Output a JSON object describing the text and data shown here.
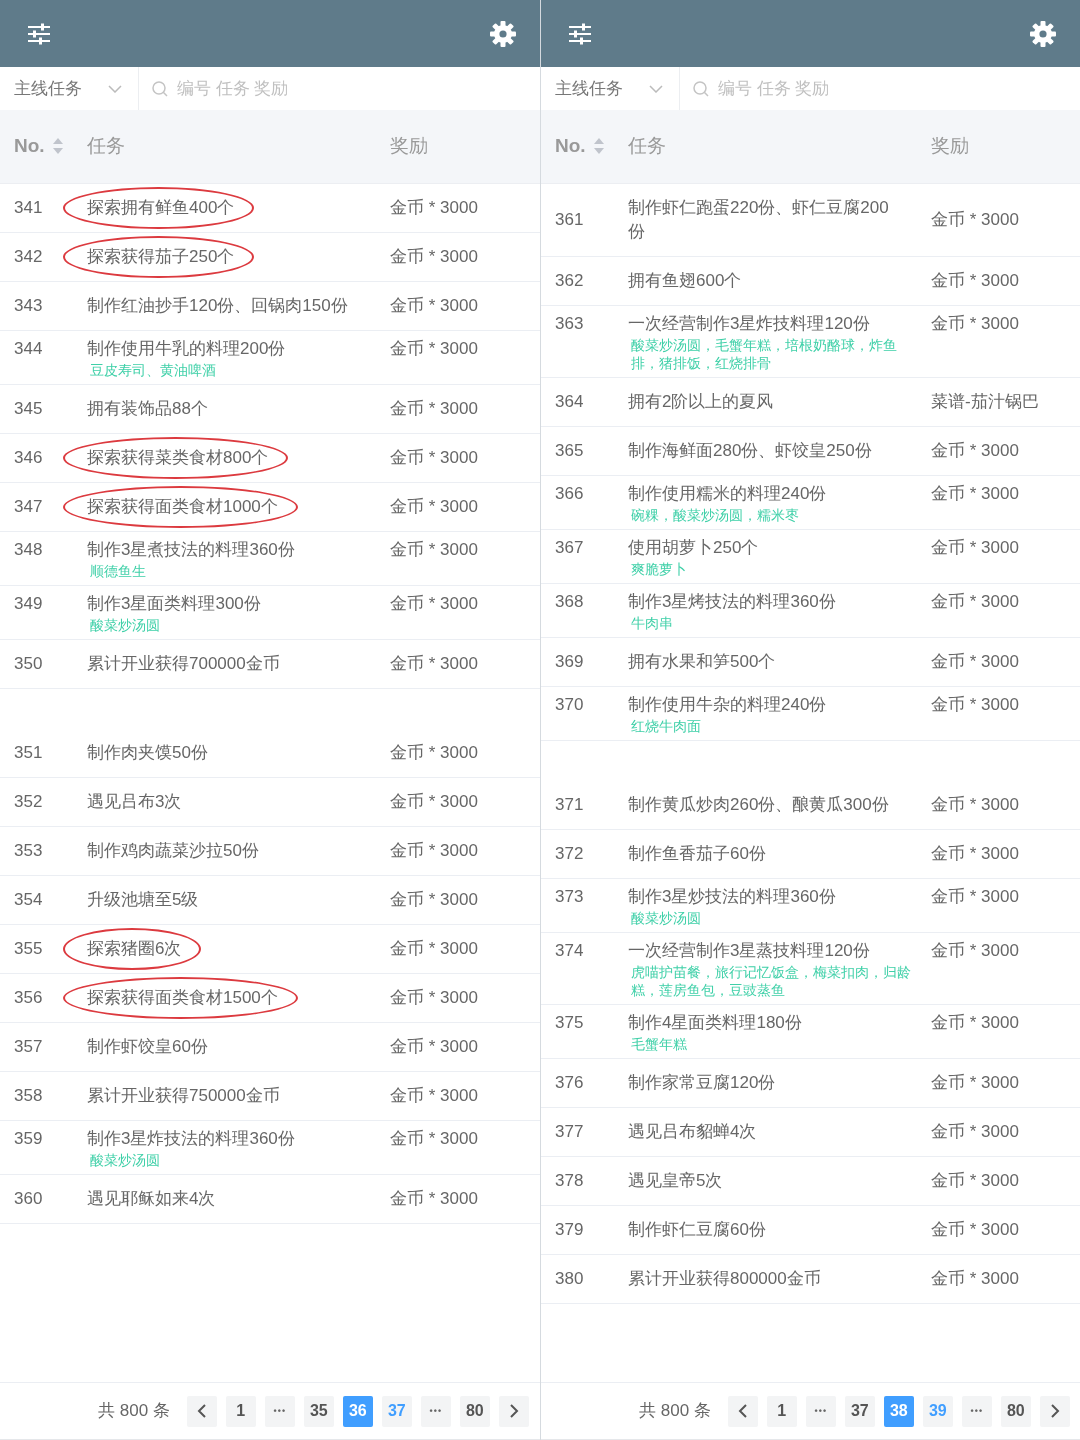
{
  "panels": [
    {
      "filter": {
        "category": "主线任务",
        "search_placeholder": "编号 任务 奖励"
      },
      "table": {
        "columns": [
          {
            "label": "No.",
            "sortable": true
          },
          {
            "label": "任务",
            "sortable": false
          },
          {
            "label": "奖励",
            "sortable": false
          }
        ],
        "sections": [
          {
            "rows": [
              {
                "no": "341",
                "task": "探索拥有鲜鱼400个",
                "reward": "金币 * 3000",
                "circled": true
              },
              {
                "no": "342",
                "task": "探索获得茄子250个",
                "reward": "金币 * 3000",
                "circled": true
              },
              {
                "no": "343",
                "task": "制作红油抄手120份、回锅肉150份",
                "reward": "金币 * 3000",
                "circled": false
              },
              {
                "no": "344",
                "task": "制作使用牛乳的料理200份",
                "note": "豆皮寿司、黄油啤酒",
                "reward": "金币 * 3000",
                "circled": false
              },
              {
                "no": "345",
                "task": "拥有装饰品88个",
                "reward": "金币 * 3000",
                "circled": false
              },
              {
                "no": "346",
                "task": "探索获得菜类食材800个",
                "reward": "金币 * 3000",
                "circled": true
              },
              {
                "no": "347",
                "task": "探索获得面类食材1000个",
                "reward": "金币 * 3000",
                "circled": true
              },
              {
                "no": "348",
                "task": "制作3星煮技法的料理360份",
                "note": "顺德鱼生",
                "reward": "金币 * 3000",
                "circled": false
              },
              {
                "no": "349",
                "task": "制作3星面类料理300份",
                "note": "酸菜炒汤圆",
                "reward": "金币 * 3000",
                "circled": false
              },
              {
                "no": "350",
                "task": "累计开业获得700000金币",
                "reward": "金币 * 3000",
                "circled": false
              }
            ]
          },
          {
            "rows": [
              {
                "no": "351",
                "task": "制作肉夹馍50份",
                "reward": "金币 * 3000",
                "circled": false
              },
              {
                "no": "352",
                "task": "遇见吕布3次",
                "reward": "金币 * 3000",
                "circled": false
              },
              {
                "no": "353",
                "task": "制作鸡肉蔬菜沙拉50份",
                "reward": "金币 * 3000",
                "circled": false
              },
              {
                "no": "354",
                "task": "升级池塘至5级",
                "reward": "金币 * 3000",
                "circled": false
              },
              {
                "no": "355",
                "task": "探索猪圈6次",
                "reward": "金币 * 3000",
                "circled": true
              },
              {
                "no": "356",
                "task": "探索获得面类食材1500个",
                "reward": "金币 * 3000",
                "circled": true
              },
              {
                "no": "357",
                "task": "制作虾饺皇60份",
                "reward": "金币 * 3000",
                "circled": false
              },
              {
                "no": "358",
                "task": "累计开业获得750000金币",
                "reward": "金币 * 3000",
                "circled": false
              },
              {
                "no": "359",
                "task": "制作3星炸技法的料理360份",
                "note": "酸菜炒汤圆",
                "reward": "金币 * 3000",
                "circled": false
              },
              {
                "no": "360",
                "task": "遇见耶稣如来4次",
                "reward": "金币 * 3000",
                "circled": false
              }
            ]
          }
        ]
      },
      "pagination": {
        "total": "共 800 条",
        "items": [
          {
            "kind": "prev",
            "selected": false,
            "hovered": false
          },
          {
            "kind": "page",
            "label": "1",
            "selected": false,
            "hovered": false
          },
          {
            "kind": "more",
            "label": "•••",
            "selected": false,
            "hovered": false
          },
          {
            "kind": "page",
            "label": "35",
            "selected": false,
            "hovered": false
          },
          {
            "kind": "page",
            "label": "36",
            "selected": true,
            "hovered": false
          },
          {
            "kind": "page",
            "label": "37",
            "selected": false,
            "hovered": true
          },
          {
            "kind": "more",
            "label": "•••",
            "selected": false,
            "hovered": false
          },
          {
            "kind": "page",
            "label": "80",
            "selected": false,
            "hovered": false
          },
          {
            "kind": "next",
            "selected": false,
            "hovered": false
          }
        ]
      }
    },
    {
      "filter": {
        "category": "主线任务",
        "search_placeholder": "编号 任务 奖励"
      },
      "table": {
        "columns": [
          {
            "label": "No.",
            "sortable": true
          },
          {
            "label": "任务",
            "sortable": false
          },
          {
            "label": "奖励",
            "sortable": false
          }
        ],
        "sections": [
          {
            "rows": [
              {
                "no": "361",
                "task": "制作虾仁跑蛋220份、虾仁豆腐200份",
                "reward": "金币 * 3000",
                "circled": false
              },
              {
                "no": "362",
                "task": "拥有鱼翅600个",
                "reward": "金币 * 3000",
                "circled": false
              },
              {
                "no": "363",
                "task": "一次经营制作3星炸技料理120份",
                "note": "酸菜炒汤圆，毛蟹年糕，培根奶酪球，炸鱼排，猪排饭，红烧排骨",
                "reward": "金币 * 3000",
                "circled": false
              },
              {
                "no": "364",
                "task": "拥有2阶以上的夏风",
                "reward": "菜谱-茄汁锅巴",
                "circled": false
              },
              {
                "no": "365",
                "task": "制作海鲜面280份、虾饺皇250份",
                "reward": "金币 * 3000",
                "circled": false
              },
              {
                "no": "366",
                "task": "制作使用糯米的料理240份",
                "note": "碗粿，酸菜炒汤圆，糯米枣",
                "reward": "金币 * 3000",
                "circled": false
              },
              {
                "no": "367",
                "task": "使用胡萝卜250个",
                "note": "爽脆萝卜",
                "reward": "金币 * 3000",
                "circled": false
              },
              {
                "no": "368",
                "task": "制作3星烤技法的料理360份",
                "note": "牛肉串",
                "reward": "金币 * 3000",
                "circled": false
              },
              {
                "no": "369",
                "task": "拥有水果和笋500个",
                "reward": "金币 * 3000",
                "circled": false
              },
              {
                "no": "370",
                "task": "制作使用牛杂的料理240份",
                "note": "红烧牛肉面",
                "reward": "金币 * 3000",
                "circled": false
              }
            ]
          },
          {
            "rows": [
              {
                "no": "371",
                "task": "制作黄瓜炒肉260份、酿黄瓜300份",
                "reward": "金币 * 3000",
                "circled": false
              },
              {
                "no": "372",
                "task": "制作鱼香茄子60份",
                "reward": "金币 * 3000",
                "circled": false
              },
              {
                "no": "373",
                "task": "制作3星炒技法的料理360份",
                "note": "酸菜炒汤圆",
                "reward": "金币 * 3000",
                "circled": false
              },
              {
                "no": "374",
                "task": "一次经营制作3星蒸技料理120份",
                "note": "虎喵护苗餐，旅行记忆饭盒，梅菜扣肉，归龄糕，莲房鱼包，豆豉蒸鱼",
                "reward": "金币 * 3000",
                "circled": false
              },
              {
                "no": "375",
                "task": "制作4星面类料理180份",
                "note": "毛蟹年糕",
                "reward": "金币 * 3000",
                "circled": false
              },
              {
                "no": "376",
                "task": "制作家常豆腐120份",
                "reward": "金币 * 3000",
                "circled": false
              },
              {
                "no": "377",
                "task": "遇见吕布貂蝉4次",
                "reward": "金币 * 3000",
                "circled": false
              },
              {
                "no": "378",
                "task": "遇见皇帝5次",
                "reward": "金币 * 3000",
                "circled": false
              },
              {
                "no": "379",
                "task": "制作虾仁豆腐60份",
                "reward": "金币 * 3000",
                "circled": false
              },
              {
                "no": "380",
                "task": "累计开业获得800000金币",
                "reward": "金币 * 3000",
                "circled": false
              }
            ]
          }
        ]
      },
      "pagination": {
        "total": "共 800 条",
        "items": [
          {
            "kind": "prev",
            "selected": false,
            "hovered": false
          },
          {
            "kind": "page",
            "label": "1",
            "selected": false,
            "hovered": false
          },
          {
            "kind": "more",
            "label": "•••",
            "selected": false,
            "hovered": false
          },
          {
            "kind": "page",
            "label": "37",
            "selected": false,
            "hovered": false
          },
          {
            "kind": "page",
            "label": "38",
            "selected": true,
            "hovered": false
          },
          {
            "kind": "page",
            "label": "39",
            "selected": false,
            "hovered": true
          },
          {
            "kind": "more",
            "label": "•••",
            "selected": false,
            "hovered": false
          },
          {
            "kind": "page",
            "label": "80",
            "selected": false,
            "hovered": false
          },
          {
            "kind": "next",
            "selected": false,
            "hovered": false
          }
        ]
      }
    }
  ]
}
